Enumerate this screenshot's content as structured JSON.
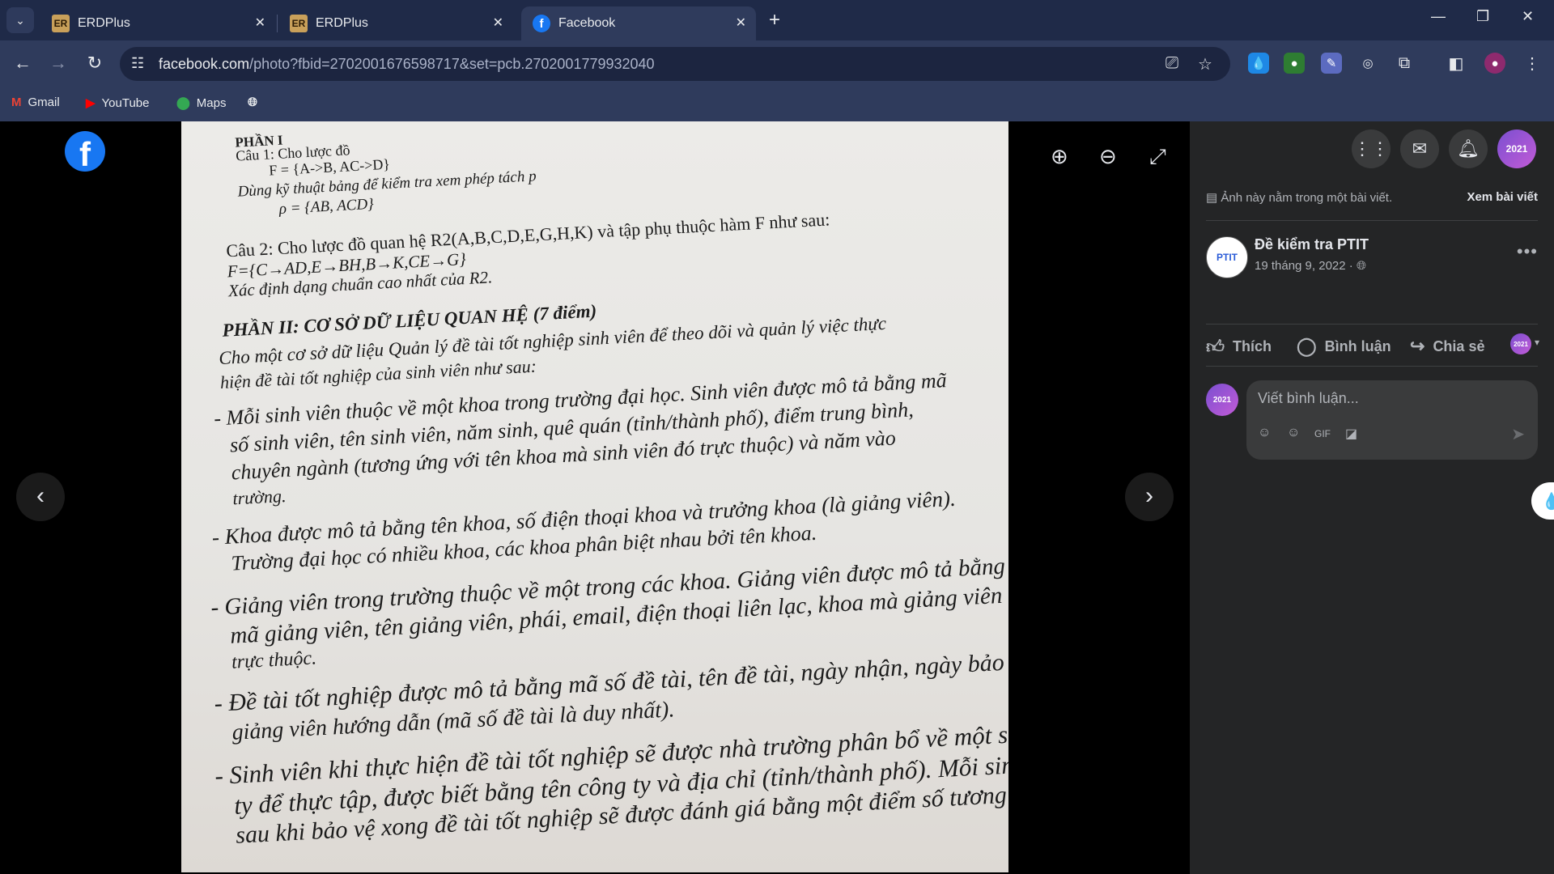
{
  "browser": {
    "tabs": [
      {
        "title": "ERDPlus",
        "favicon": "ER"
      },
      {
        "title": "ERDPlus",
        "favicon": "ER"
      },
      {
        "title": "Facebook",
        "favicon": "f"
      }
    ],
    "url_domain": "facebook.com",
    "url_path": "/photo?fbid=2702001676598717&set=pcb.2702001779932040",
    "bookmarks": [
      "Gmail",
      "YouTube",
      "Maps"
    ]
  },
  "photo_text": {
    "l1": "PHẦN I",
    "l2": "Câu 1: Cho lược đồ",
    "l3": "F = {A->B, AC->D}",
    "l4": "Dùng kỹ thuật bảng để kiểm tra xem phép tách p",
    "l5": "ρ = {AB, ACD}",
    "l6": "Câu 2: Cho lược đồ quan hệ R2(A,B,C,D,E,G,H,K) và tập phụ thuộc hàm F như sau:",
    "l7": "F={C→AD,E→BH,B→K,CE→G}",
    "l8": "Xác định dạng chuẩn cao nhất của R2.",
    "l9": "PHẦN II: CƠ SỞ DỮ LIỆU QUAN HỆ (7 điểm)",
    "l10": "Cho một cơ sở dữ liệu Quản lý đề tài tốt nghiệp sinh viên để theo dõi và quản lý việc thực",
    "l11": "hiện đề tài tốt nghiệp của sinh viên như sau:",
    "l12": "-  Mỗi sinh viên thuộc về một khoa trong trường đại học. Sinh viên được mô tả bằng mã",
    "l13": "số sinh viên, tên sinh viên, năm sinh, quê quán (tỉnh/thành phố), điểm trung bình,",
    "l14": "chuyên ngành (tương ứng với tên khoa mà sinh viên đó trực thuộc) và năm vào",
    "l15": "trường.",
    "l16": "-  Khoa được mô tả bằng tên khoa, số điện thoại khoa và trưởng khoa (là giảng viên).",
    "l17": "Trường đại học có nhiều khoa, các khoa phân biệt nhau bởi tên khoa.",
    "l18": "-  Giảng viên trong trường thuộc về một trong các khoa. Giảng viên được mô tả bằng",
    "l19": "mã giảng viên, tên giảng viên, phái, email, điện thoại liên lạc, khoa mà giảng viên đó",
    "l20": "trực thuộc.",
    "l21": "-  Đề tài tốt nghiệp được mô tả bằng mã số đề tài, tên đề tài, ngày nhận, ngày bảo vệ",
    "l22": "giảng viên hướng dẫn (mã số đề tài là duy nhất).",
    "l23": "-  Sinh viên khi thực hiện đề tài tốt nghiệp sẽ được nhà trường phân bổ về một số côn",
    "l24": "ty để thực tập, được biết bằng tên công ty và địa chỉ (tỉnh/thành phố). Mỗi sinh vi",
    "l25": "sau khi bảo vệ xong đề tài tốt nghiệp sẽ được đánh giá bằng một điểm số tương ứng"
  },
  "panel": {
    "info_text": "Ảnh này nằm trong một bài viết.",
    "view_post": "Xem bài viết",
    "page_name": "Đề kiểm tra PTIT",
    "post_date": "19 tháng 9, 2022 ·",
    "like": "Thích",
    "comment": "Bình luận",
    "share": "Chia sẻ",
    "comment_placeholder": "Viết bình luận..."
  },
  "colors": {
    "facebook_blue": "#1877f2",
    "panel_bg": "#242526",
    "chrome_bg": "#2f3b5c"
  }
}
